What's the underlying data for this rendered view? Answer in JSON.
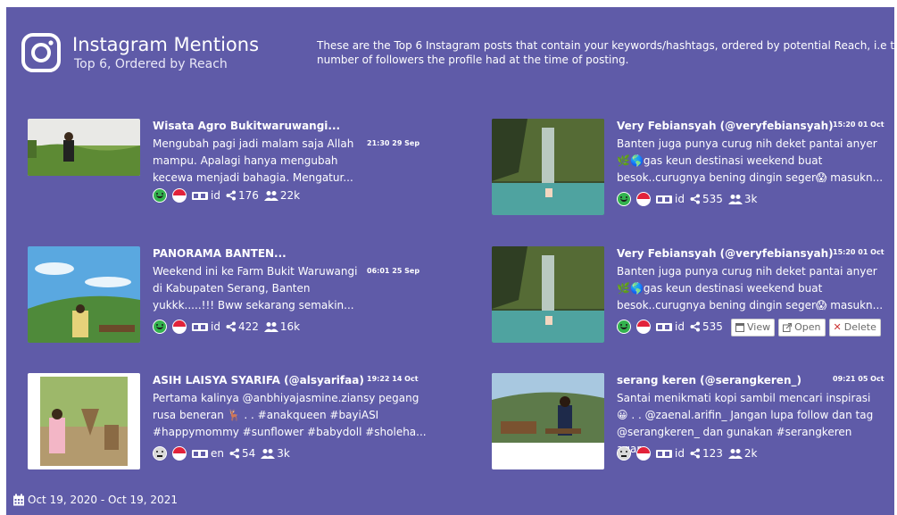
{
  "header": {
    "title": "Instagram Mentions",
    "subtitle": "Top 6, Ordered by Reach",
    "description": "These are the Top 6 Instagram posts that contain your keywords/hashtags, ordered by potential Reach, i.e t number of followers the profile had at the time of posting."
  },
  "posts": [
    {
      "title": "Wisata Agro Bukitwaruwangi...",
      "time": "21:30 29 Sep",
      "text": "Mengubah pagi jadi malam saja Allah mampu. Apalagi hanya mengubah kecewa menjadi bahagia. Mengatur...",
      "sentiment": "positive",
      "lang": "id",
      "shares": "176",
      "followers": "22k"
    },
    {
      "title": "Very Febiansyah (@veryfebiansyah)",
      "time": "15:20 01 Oct",
      "text": "Banten juga punya curug nih deket pantai anyer 🌿🌎gas keun destinasi weekend buat besok..curugnya bening dingin seger😱 masukn...",
      "sentiment": "positive",
      "lang": "id",
      "shares": "535",
      "followers": "3k"
    },
    {
      "title": "PANORAMA BANTEN...",
      "time": "06:01 25 Sep",
      "text": "Weekend ini ke Farm Bukit Waruwangi di Kabupaten Serang, Banten yukkk.....!!! Bww sekarang semakin...",
      "sentiment": "positive",
      "lang": "id",
      "shares": "422",
      "followers": "16k"
    },
    {
      "title": "Very Febiansyah (@veryfebiansyah)",
      "time": "15:20 01 Oct",
      "text": "Banten juga punya curug nih deket pantai anyer 🌿🌎gas keun destinasi weekend buat besok..curugnya bening dingin seger😱 masukn...",
      "sentiment": "positive",
      "lang": "id",
      "shares": "535",
      "followers": "3k",
      "actions": {
        "view": "View",
        "open": "Open",
        "delete": "Delete"
      }
    },
    {
      "title": "ASIH LAISYA SYARIFA (@alsyarifaa)",
      "time": "19:22 14 Oct",
      "text": "Pertama kalinya @anbhiyajasmine.ziansy pegang rusa beneran 🦌 . . #anakqueen #bayiASI #happymommy #sunflower #babydoll #sholeha...",
      "sentiment": "neutral",
      "lang": "en",
      "shares": "54",
      "followers": "3k"
    },
    {
      "title": "serang keren (@serangkeren_)",
      "time": "09:21 05 Oct",
      "text": "Santai menikmati kopi sambil mencari inspirasi 😀 . . @zaenal.arifin_ Jangan lupa follow dan tag @serangkeren_ dan gunakan #serangkeren agar...",
      "sentiment": "neutral",
      "lang": "id",
      "shares": "123",
      "followers": "2k"
    }
  ],
  "footer": {
    "date_range": "Oct 19, 2020 - Oct 19, 2021"
  },
  "colors": {
    "panel": "#5f5ba8",
    "positive": "#33b24e",
    "flag_red": "#e2223a"
  }
}
